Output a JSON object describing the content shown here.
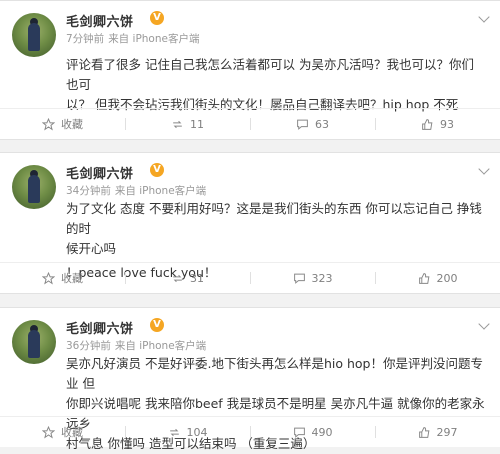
{
  "posts": [
    {
      "user": "毛剑卿六饼",
      "verified": "V",
      "time": "7分钟前",
      "source": "来自 iPhone客户端",
      "lines": [
        "评论看了很多 记住自己我怎么活着都可以 为吴亦凡活吗？我也可以？你们也可",
        "以？ 但我不会玷污我们街头的文化！屡品自己翻译去吧？hip hop 不死"
      ],
      "actions": {
        "favorite": "收藏",
        "repost": "11",
        "comment": "63",
        "like": "93"
      }
    },
    {
      "user": "毛剑卿六饼",
      "verified": "V",
      "time": "34分钟前",
      "source": "来自 iPhone客户端",
      "lines": [
        "为了文化 态度  不要利用好吗？这是是我们街头的东西 你可以忘记自己 挣钱的时",
        "候开心吗",
        "！peace love fuck you！"
      ],
      "actions": {
        "favorite": "收藏",
        "repost": "31",
        "comment": "323",
        "like": "200"
      }
    },
    {
      "user": "毛剑卿六饼",
      "verified": "V",
      "time": "36分钟前",
      "source": "来自 iPhone客户端",
      "lines": [
        "吴亦凡好演员 不是好评委.地下街头再怎么样是hio hop！你是评判没问题专业 但",
        "你即兴说唱呢 我来陪你beef 我是球员不是明星 吴亦凡牛逼 就像你的老家永远乡",
        "村气息 你懂吗 造型可以结束吗 （重复三遍）"
      ],
      "actions": {
        "favorite": "收藏",
        "repost": "104",
        "comment": "490",
        "like": "297"
      }
    }
  ]
}
